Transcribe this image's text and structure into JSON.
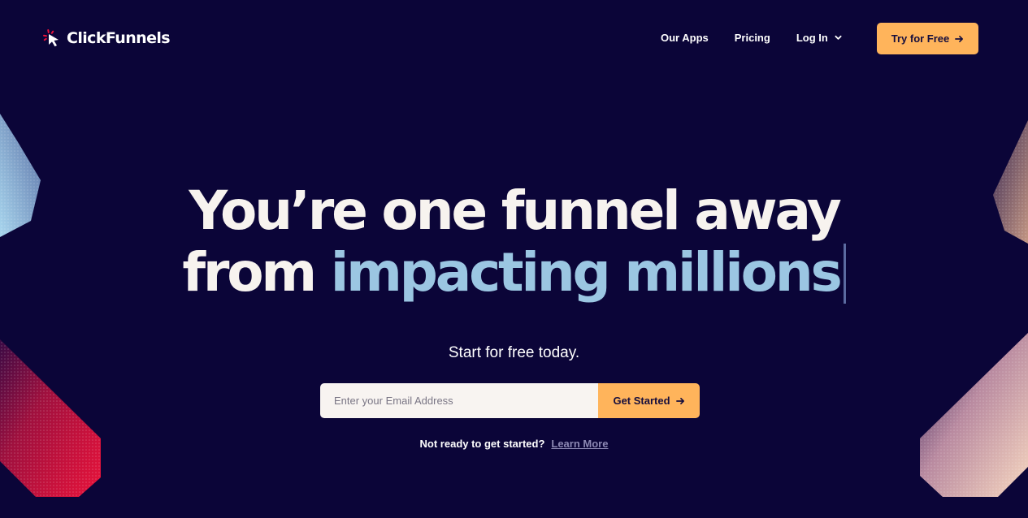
{
  "brand": {
    "name": "ClickFunnels",
    "logo_icon": "cursor-click-icon"
  },
  "nav": {
    "our_apps": "Our Apps",
    "pricing": "Pricing",
    "log_in": "Log In",
    "log_in_icon": "chevron-down-icon"
  },
  "header_cta": {
    "label": "Try for Free",
    "icon": "arrow-right-icon"
  },
  "hero": {
    "title_line1": "You’re one funnel away",
    "title_line2_prefix": "from",
    "title_line2_highlight": "impacting millions",
    "subhead": "Start for free today."
  },
  "signup": {
    "email_placeholder": "Enter your Email Address",
    "email_value": "",
    "button_label": "Get Started",
    "button_icon": "arrow-right-icon"
  },
  "footnote": {
    "text": "Not ready to get started?",
    "link": "Learn More"
  },
  "colors": {
    "background": "#0b0538",
    "accent": "#ffb45b",
    "highlight": "#9bc6e2",
    "hero_text": "#f7f3ef",
    "input_bg": "#f8f4f1",
    "muted_link": "#8c88b3"
  }
}
